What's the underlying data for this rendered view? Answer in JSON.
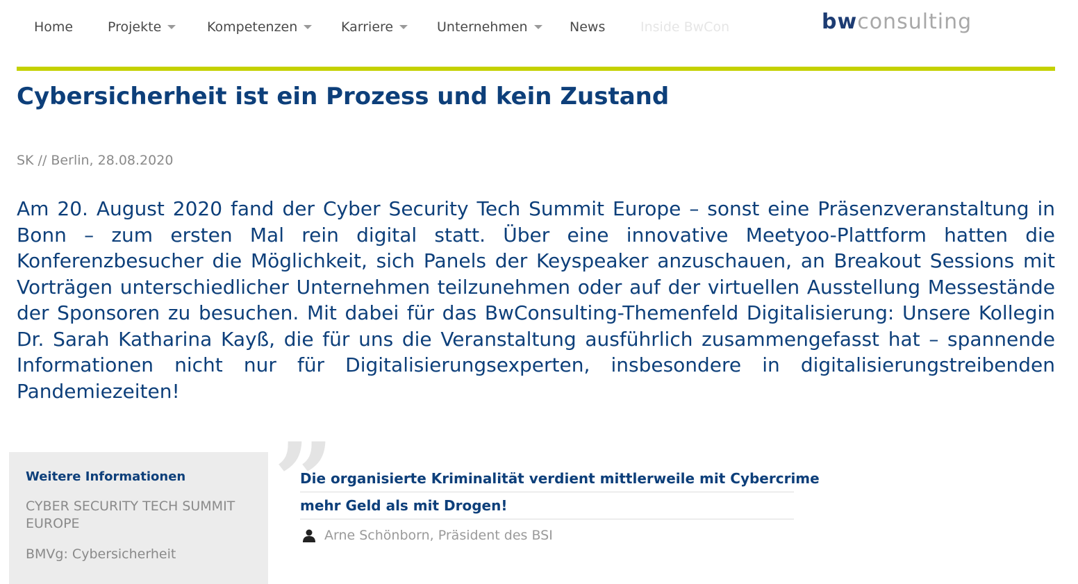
{
  "nav": {
    "items": [
      {
        "label": "Home",
        "dropdown": false,
        "disabled": false
      },
      {
        "label": "Projekte",
        "dropdown": true,
        "disabled": false
      },
      {
        "label": "Kompetenzen",
        "dropdown": true,
        "disabled": false
      },
      {
        "label": "Karriere",
        "dropdown": true,
        "disabled": false
      },
      {
        "label": "Unternehmen",
        "dropdown": true,
        "disabled": false
      },
      {
        "label": "News",
        "dropdown": false,
        "disabled": false
      },
      {
        "label": "Inside BwCon",
        "dropdown": false,
        "disabled": true
      }
    ],
    "caret_icon": "chevron-down-icon"
  },
  "logo": {
    "part1": "bw",
    "part2": "consulting",
    "color_primary": "#1d3c73",
    "color_secondary": "#a8a8a8"
  },
  "colors": {
    "accent_rule": "#c4d100",
    "text_blue": "#0d3f7a",
    "text_gray": "#8a8a8a",
    "box_background": "#ececec"
  },
  "article": {
    "title": "Cybersicherheit ist ein Prozess und kein Zustand",
    "byline": "SK // Berlin, 28.08.2020",
    "body": "Am 20. August 2020 fand der Cyber Security Tech Summit Europe – sonst eine Präsenzveranstaltung in Bonn – zum ersten Mal rein digital statt. Über eine innovative Meetyoo-Plattform hatten die Konferenzbesucher die Möglichkeit, sich Panels der Keyspeaker anzuschauen, an Breakout Sessions mit Vorträgen unterschiedlicher Unternehmen teilzunehmen oder auf der virtuellen Ausstellung Messestände der Sponsoren zu besuchen. Mit dabei für das BwConsulting-Themenfeld Digitalisierung: Unsere Kollegin Dr. Sarah Katharina Kayß, die für uns die Veranstaltung ausführlich zusammengefasst hat – spannende Informationen nicht nur für Digitalisierungsexperten, insbesondere in digitalisierungstreibenden Pandemiezeiten!"
  },
  "info_box": {
    "title": "Weitere Informationen",
    "links": [
      "CYBER SECURITY TECH SUMMIT EUROPE",
      "BMVg: Cybersicherheit"
    ]
  },
  "quote": {
    "mark": "”",
    "lines": [
      "Die organisierte Kriminalität verdient mittlerweile mit Cybercrime",
      "mehr Geld als mit Drogen!"
    ],
    "author": "Arne Schönborn, Präsident des BSI",
    "author_icon": "person-icon"
  }
}
